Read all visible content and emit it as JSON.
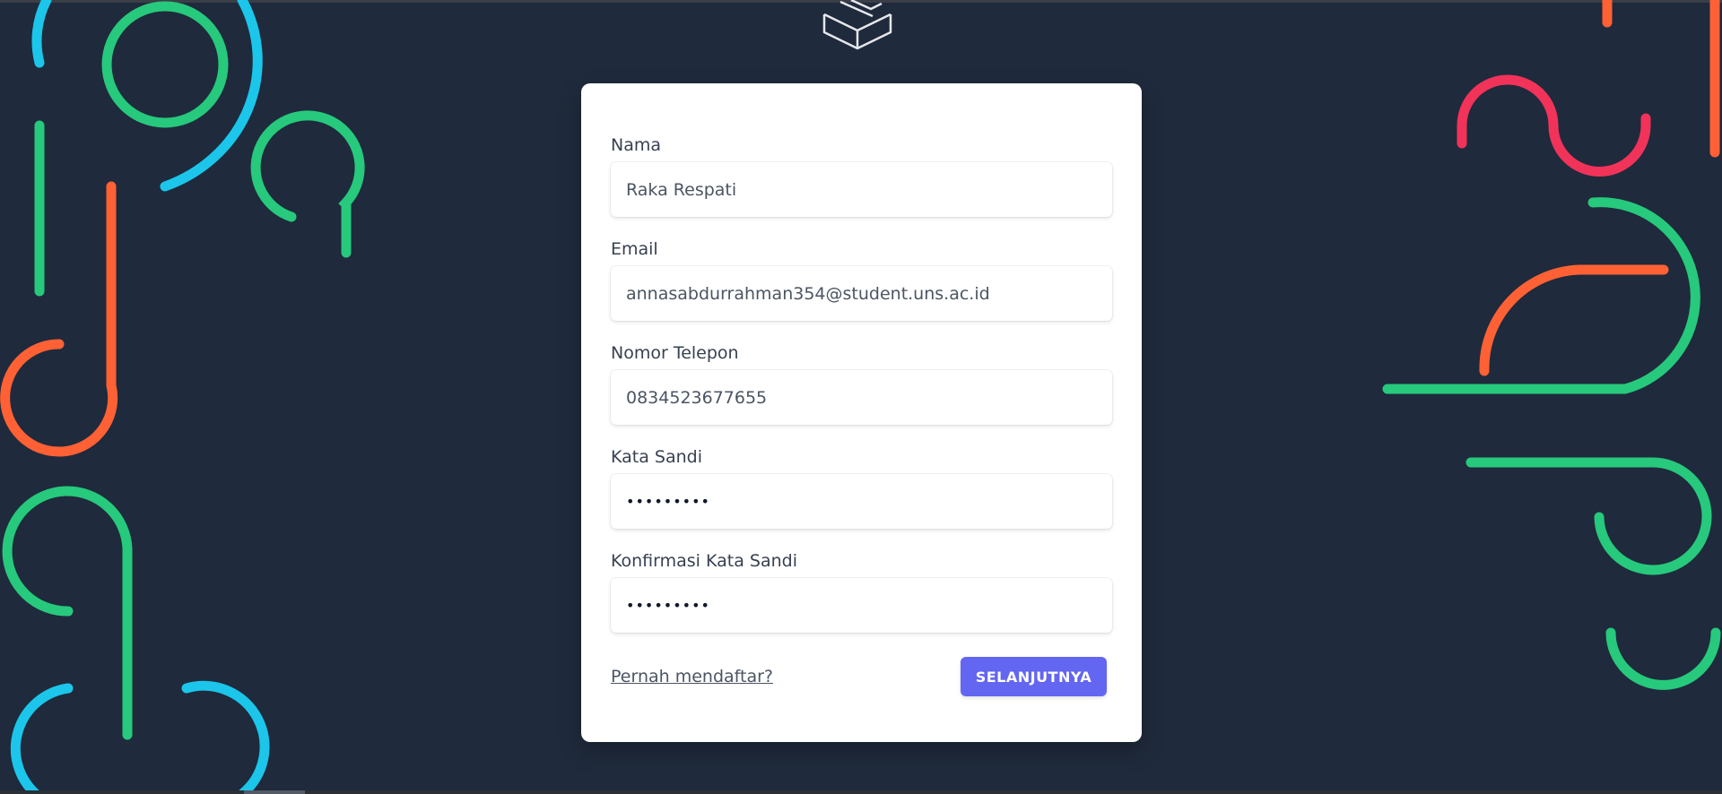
{
  "app": {
    "accent_color": "#6366f1",
    "background_color": "#1f2a3c",
    "card_color": "#ffffff"
  },
  "logo": {
    "icon": "package-box-icon"
  },
  "form": {
    "fields": [
      {
        "label": "Nama",
        "value": "Raka Respati"
      },
      {
        "label": "Email",
        "value": "annasabdurrahman354@student.uns.ac.id"
      },
      {
        "label": "Nomor Telepon",
        "value": "0834523677655"
      },
      {
        "label": "Kata Sandi",
        "value": "•••••••••"
      },
      {
        "label": "Konfirmasi Kata Sandi",
        "value": "•••••••••"
      }
    ],
    "login_link": "Pernah mendaftar?",
    "next_button": "SELANJUTNYA"
  },
  "decoration_colors": {
    "green": "#27c97c",
    "cyan": "#1bc6ea",
    "orange": "#ff6135",
    "pink": "#f1335a"
  }
}
